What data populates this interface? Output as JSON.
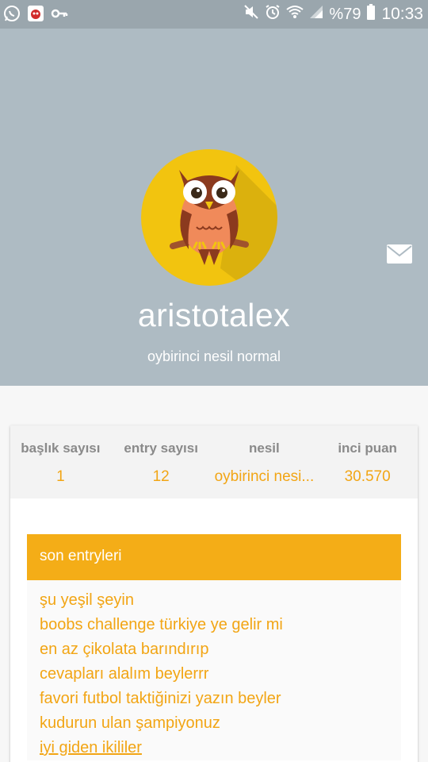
{
  "status_bar": {
    "battery_percent": "%79",
    "time": "10:33",
    "icons": [
      "whatsapp-icon",
      "app-notification-icon",
      "key-icon",
      "mute-icon",
      "alarm-icon",
      "wifi-icon",
      "signal-icon",
      "battery-icon"
    ]
  },
  "profile": {
    "username": "aristotalex",
    "generation": "oybirinci nesil normal",
    "avatar": "owl-avatar"
  },
  "stats": [
    {
      "label": "başlık sayısı",
      "value": "1"
    },
    {
      "label": "entry sayısı",
      "value": "12"
    },
    {
      "label": "nesil",
      "value": "oybirinci nesi..."
    },
    {
      "label": "inci puan",
      "value": "30.570"
    }
  ],
  "recent_entries": {
    "title": "son entryleri",
    "items": [
      "şu yeşil şeyin",
      "boobs challenge türkiye ye gelir mi",
      "en az çikolata barındırıp",
      "cevapları alalım beylerrr",
      "favori futbol taktiğinizi yazın beyler",
      "kudurun ulan şampiyonuz",
      "iyi giden ikililer"
    ]
  },
  "colors": {
    "accent": "#f4ad17",
    "header_bg": "#aebbc3",
    "status_bar_bg": "#9aa6ad",
    "avatar_circle": "#f2c40f"
  }
}
